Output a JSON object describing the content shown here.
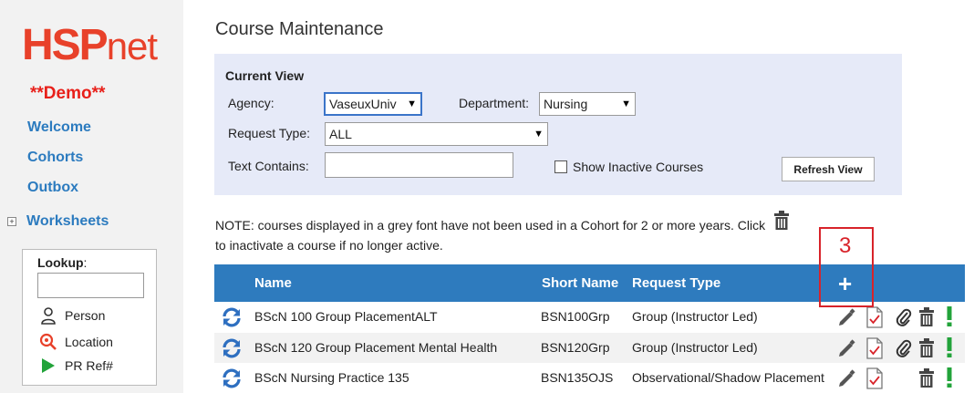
{
  "sidebar": {
    "logo": {
      "part1": "HSP",
      "part2": "net"
    },
    "demo_label": "**Demo**",
    "links": [
      "Welcome",
      "Cohorts",
      "Outbox"
    ],
    "worksheets": {
      "expander": "+",
      "label": "Worksheets"
    },
    "lookup": {
      "title": "Lookup",
      "title_suffix": ":",
      "input_value": "",
      "items": [
        "Person",
        "Location",
        "PR Ref#"
      ]
    }
  },
  "main": {
    "title": "Course Maintenance",
    "current_view": {
      "title": "Current View",
      "agency_label": "Agency:",
      "agency_value": "VaseuxUniv",
      "department_label": "Department:",
      "department_value": "Nursing",
      "request_type_label": "Request Type:",
      "request_type_value": "ALL",
      "text_contains_label": "Text Contains:",
      "text_contains_value": "",
      "show_inactive_label": "Show Inactive Courses",
      "show_inactive_checked": false,
      "refresh_label": "Refresh View"
    },
    "note": {
      "part1": "NOTE: courses displayed in a grey font have not been used in a Cohort for 2 or more years. Click",
      "part2": "to inactivate a course if no longer active."
    },
    "table": {
      "headers": {
        "name": "Name",
        "short_name": "Short Name",
        "request_type": "Request Type",
        "add": "+"
      },
      "rows": [
        {
          "name": "BScN 100 Group PlacementALT",
          "short_name": "BSN100Grp",
          "request_type": "Group (Instructor Led)",
          "has_attachment": true
        },
        {
          "name": "BScN 120 Group Placement Mental Health",
          "short_name": "BSN120Grp",
          "request_type": "Group (Instructor Led)",
          "has_attachment": true
        },
        {
          "name": "BScN Nursing Practice 135",
          "short_name": "BSN135OJS",
          "request_type": "Observational/Shadow Placement",
          "has_attachment": false
        }
      ]
    },
    "annotation": {
      "number": "3",
      "color": "#d8232a"
    }
  },
  "colors": {
    "brand": "#e8412a",
    "link": "#2c7bbf",
    "table_header": "#2e7bbe",
    "panel": "#e6eaf8",
    "status_green": "#22a33a"
  },
  "icons": {
    "row": [
      "sync-icon",
      "pencil-icon",
      "checklist-icon",
      "paperclip-icon",
      "trash-icon",
      "exclamation-icon"
    ]
  }
}
